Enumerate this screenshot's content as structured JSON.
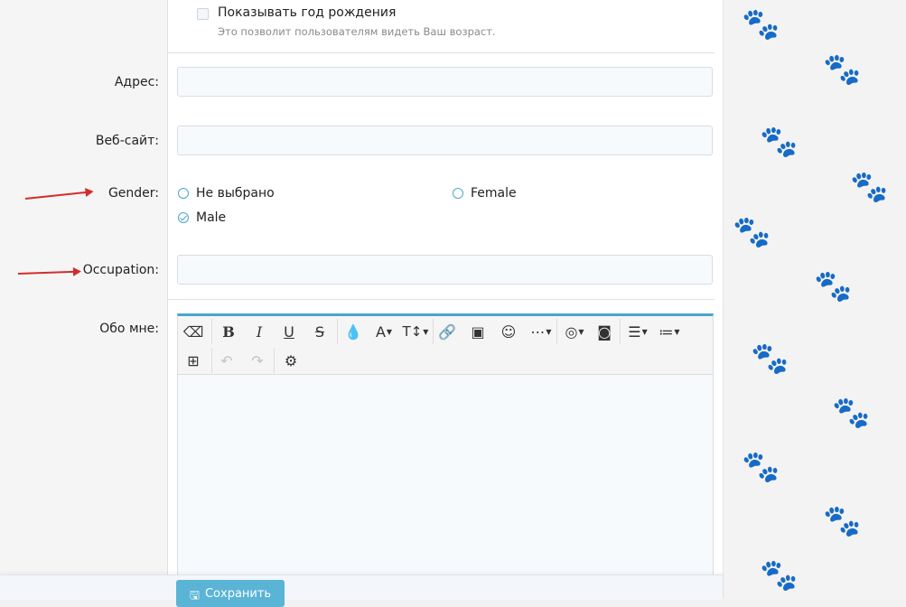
{
  "birth_year": {
    "label": "Показывать год рождения",
    "hint": "Это позволит пользователям видеть Ваш возраст."
  },
  "fields": {
    "address_label": "Адрес:",
    "address_value": "",
    "website_label": "Веб-сайт:",
    "website_value": "",
    "occupation_label": "Occupation:",
    "occupation_value": "",
    "about_label": "Обо мне:"
  },
  "gender": {
    "label": "Gender:",
    "options": [
      {
        "label": "Не выбрано",
        "checked": false
      },
      {
        "label": "Female",
        "checked": false
      },
      {
        "label": "Male",
        "checked": true
      }
    ]
  },
  "toolbar": {
    "icons": [
      "eraser-icon",
      "bold-icon",
      "italic-icon",
      "underline-icon",
      "strikethrough-icon",
      "color-icon",
      "font-family-icon",
      "font-size-icon",
      "link-icon",
      "image-icon",
      "smiley-icon",
      "more-icon",
      "spoiler-icon",
      "media-icon",
      "align-icon",
      "list-icon",
      "table-icon",
      "undo-icon",
      "redo-icon",
      "settings-icon"
    ]
  },
  "footer": {
    "save_label": "Сохранить"
  },
  "colors": {
    "accent": "#47a7c9",
    "button": "#5ab4d6",
    "arrow": "#d42c2c"
  }
}
